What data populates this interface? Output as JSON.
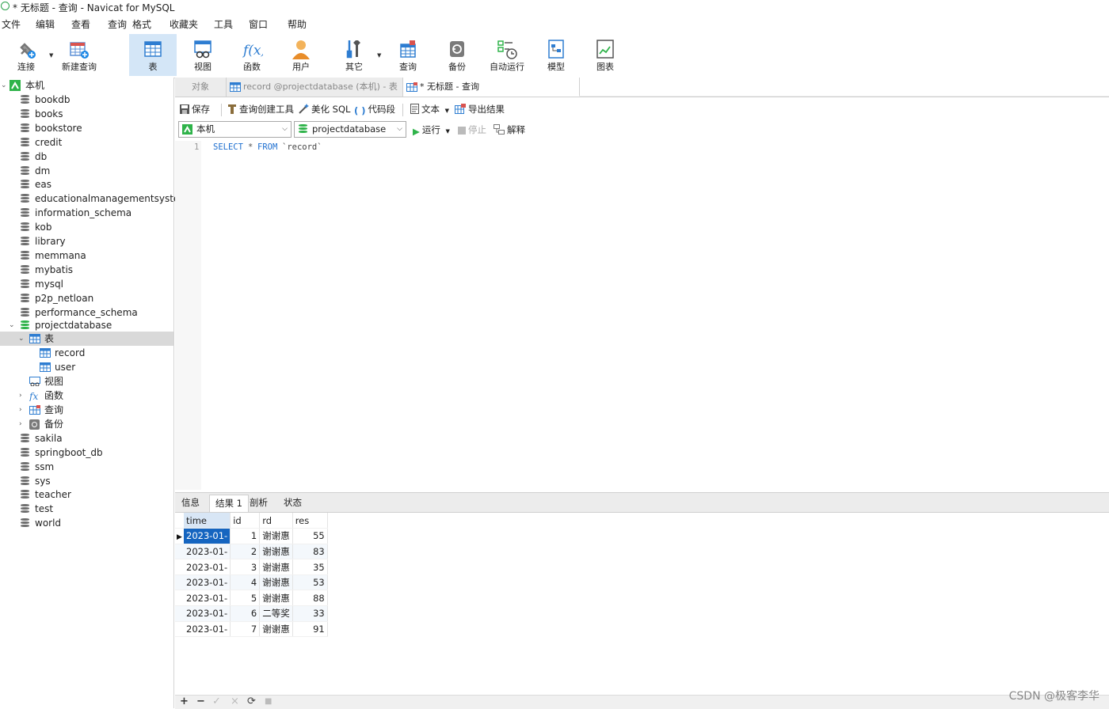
{
  "window": {
    "title": "* 无标题 - 查询 - Navicat for MySQL"
  },
  "menu": [
    "文件",
    "编辑",
    "查看",
    "查询",
    "格式",
    "收藏夹",
    "工具",
    "窗口",
    "帮助"
  ],
  "toolbar": {
    "connect": "连接",
    "new_query": "新建查询",
    "table": "表",
    "view": "视图",
    "function": "函数",
    "user": "用户",
    "other": "其它",
    "query": "查询",
    "backup": "备份",
    "automation": "自动运行",
    "model": "模型",
    "chart": "图表"
  },
  "tree": {
    "root": "本机",
    "databases": [
      "bookdb",
      "books",
      "bookstore",
      "credit",
      "db",
      "dm",
      "eas",
      "educationalmanagementsystem",
      "information_schema",
      "kob",
      "library",
      "memmana",
      "mybatis",
      "mysql",
      "p2p_netloan",
      "performance_schema"
    ],
    "open_db": "projectdatabase",
    "tables_label": "表",
    "tables": [
      "record",
      "user"
    ],
    "views_label": "视图",
    "functions_label": "函数",
    "queries_label": "查询",
    "backups_label": "备份",
    "more_databases": [
      "sakila",
      "springboot_db",
      "ssm",
      "sys",
      "teacher",
      "test",
      "world"
    ]
  },
  "tabs": {
    "objects": "对象",
    "record": "record @projectdatabase (本机) - 表",
    "query": "* 无标题 - 查询"
  },
  "query_toolbar": {
    "save": "保存",
    "builder": "查询创建工具",
    "beautify": "美化 SQL",
    "snippet": "代码段",
    "text": "文本",
    "export": "导出结果"
  },
  "selectors": {
    "connection": "本机",
    "database": "projectdatabase",
    "run": "运行",
    "stop": "停止",
    "explain": "解释"
  },
  "editor": {
    "line_number": "1",
    "kw_select": "SELECT",
    "star": "*",
    "kw_from": "FROM",
    "table": "`record`"
  },
  "results": {
    "tabs": [
      "信息",
      "结果 1",
      "剖析",
      "状态"
    ],
    "active_tab": 1,
    "columns": [
      "time",
      "id",
      "rd",
      "res"
    ],
    "rows": [
      [
        "2023-01-",
        "1",
        "谢谢惠",
        "55"
      ],
      [
        "2023-01-",
        "2",
        "谢谢惠",
        "83"
      ],
      [
        "2023-01-",
        "3",
        "谢谢惠",
        "35"
      ],
      [
        "2023-01-",
        "4",
        "谢谢惠",
        "53"
      ],
      [
        "2023-01-",
        "5",
        "谢谢惠",
        "88"
      ],
      [
        "2023-01-",
        "6",
        "二等奖",
        "33"
      ],
      [
        "2023-01-",
        "7",
        "谢谢惠",
        "91"
      ]
    ]
  },
  "statusbar": {
    "add": "+",
    "remove": "−",
    "apply": "✓",
    "discard": "×",
    "refresh": "⟳",
    "stop": "■"
  },
  "watermark": "CSDN @极客李华",
  "colors": {
    "accent": "#1e88e5",
    "selection": "#1565c0",
    "active_tool": "#d4e6f7",
    "green": "#2fb34a"
  }
}
